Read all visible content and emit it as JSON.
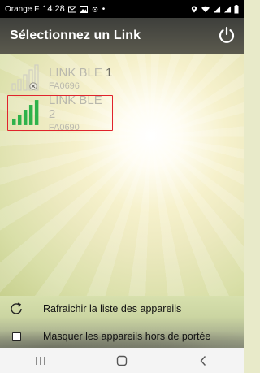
{
  "status_bar": {
    "carrier": "Orange F",
    "time": "14:28"
  },
  "header": {
    "title": "Sélectionnez un Link"
  },
  "devices": [
    {
      "name_prefix": "LINK BLE ",
      "name_num": "1",
      "id": "FA0696",
      "signal": "none",
      "selected": false
    },
    {
      "name_prefix": "LINK BLE ",
      "name_num": "2",
      "id": "FA0690",
      "signal": "full",
      "selected": true
    }
  ],
  "actions": {
    "refresh_label": "Rafraichir la liste des appareils",
    "hide_label": "Masquer les appareils hors de portée",
    "hide_checked": false
  },
  "colors": {
    "signal_active": "#2db24a",
    "signal_inactive": "#d9d8cc",
    "selection_border": "#e0232c"
  }
}
